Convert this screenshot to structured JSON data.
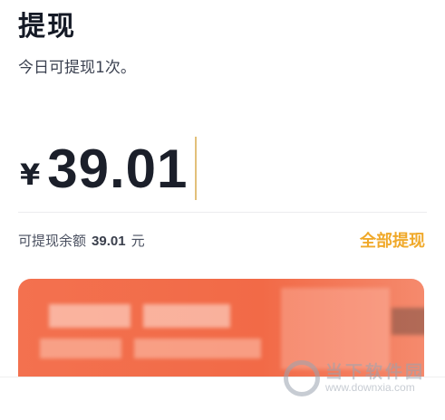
{
  "header": {
    "title": "提现",
    "subtitle": "今日可提现1次。"
  },
  "amount": {
    "currency_symbol": "¥",
    "value": "39.01"
  },
  "balance": {
    "label": "可提现余额",
    "value": "39.01",
    "unit": "元",
    "withdraw_all_label": "全部提现"
  },
  "watermark": {
    "title": "当下软件园",
    "url": "www.downxia.com"
  },
  "colors": {
    "accent": "#f0a92a",
    "card": "#f26a47",
    "text": "#1b1f2a"
  }
}
